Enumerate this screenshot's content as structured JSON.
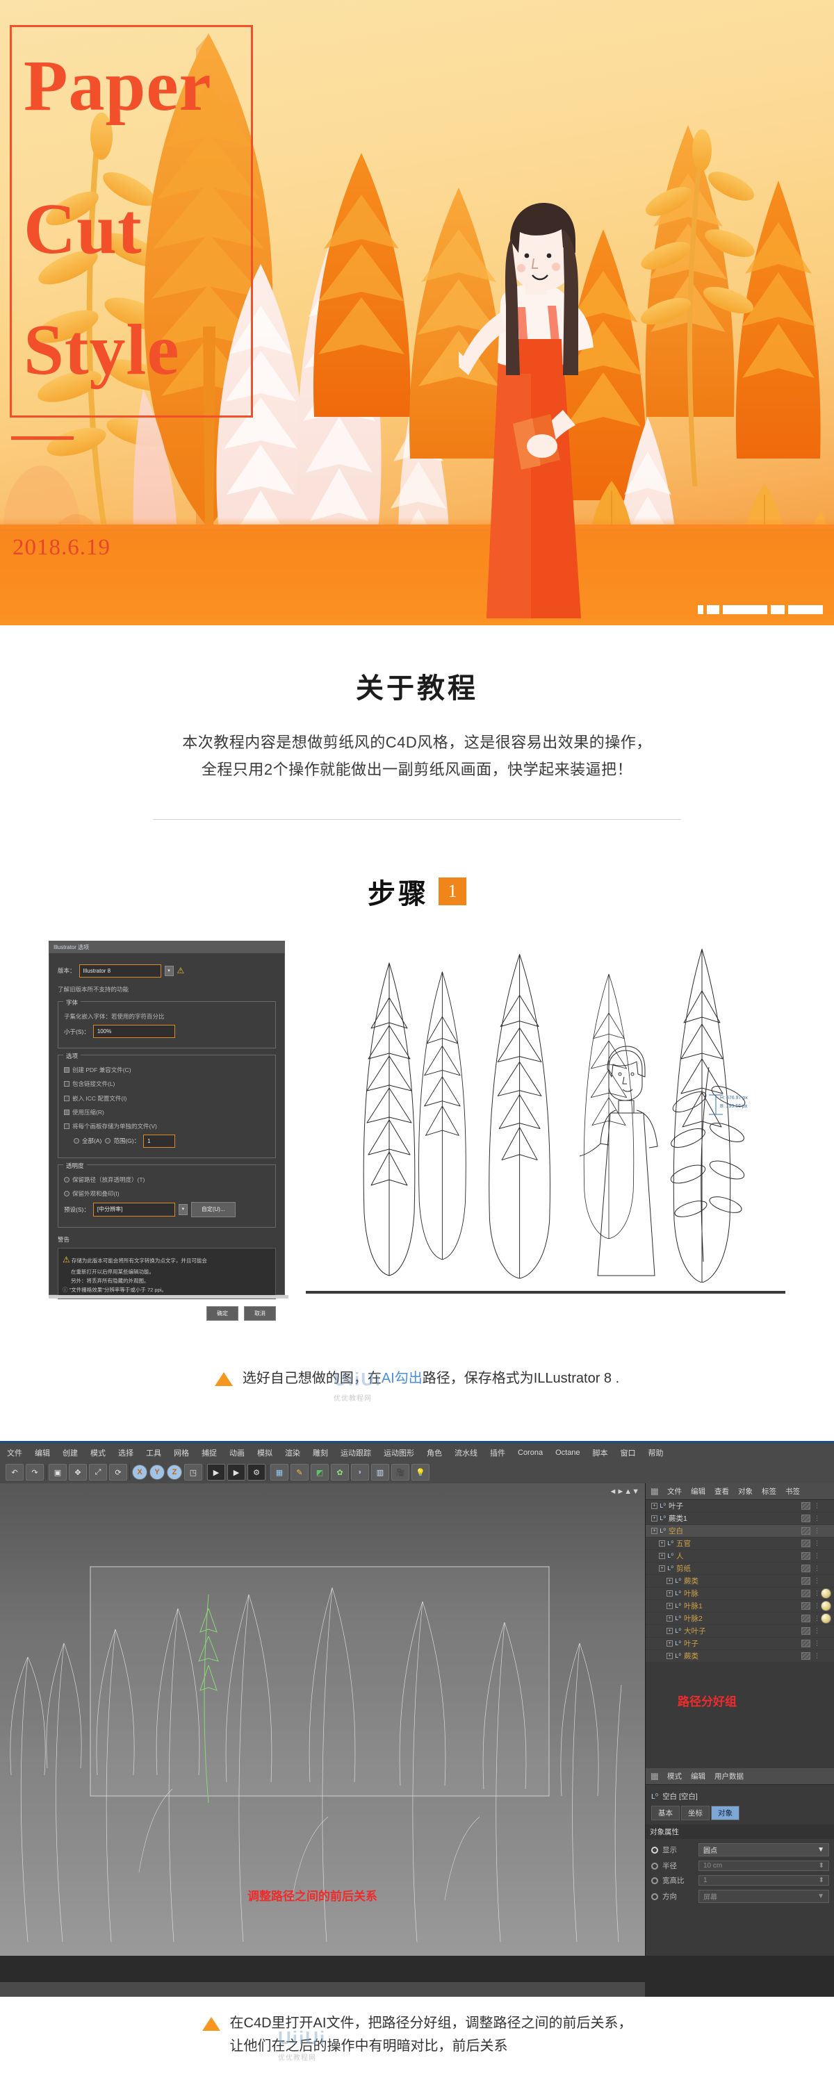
{
  "hero": {
    "title_lines": [
      "Paper",
      "Cut",
      "Style"
    ],
    "date": "2018.6.19",
    "frame_color": "#f2502a",
    "title_color": "#f2502a",
    "pager_dots": 5
  },
  "about": {
    "heading": "关于教程",
    "paragraph_line1": "本次教程内容是想做剪纸风的C4D风格，这是很容易出效果的操作，",
    "paragraph_line2": "全程只用2个操作就能做出一副剪纸风画面，快学起来装逼把！"
  },
  "step1": {
    "heading": "步骤",
    "number": "1",
    "accent_color": "#f08519",
    "caption_pre": "选好自己想做的图，在",
    "caption_hl": "AI勾出",
    "caption_post": "路径，保存格式为ILLustrator 8 .",
    "watermark": "优优教程网",
    "ai_dialog": {
      "title": "Illustrator 选项",
      "version_label": "版本：",
      "version_value": "Illustrator 8",
      "note": "了解旧版本所不支持的功能",
      "font_group": "字体",
      "font_line1": "子集化嵌入字体：若使用的字符百分比",
      "font_line2": "小于(S)：",
      "font_value": "100%",
      "options_group": "选项",
      "opt1": "创建 PDF 兼容文件(C)",
      "opt2": "包含链接文件(L)",
      "opt3": "嵌入 ICC 配置文件(I)",
      "opt4": "使用压缩(R)",
      "opt5": "将每个画板存储为单独的文件(V)",
      "opt_radio1": "全部(A)",
      "opt_radio2": "范围(G)：",
      "range_value": "1",
      "trans_group": "透明度",
      "trans1": "保留路径（放弃透明度）(T)",
      "trans2": "保留外观和叠印(I)",
      "preset_label": "预设(S)：",
      "preset_value": "[中分辨率]",
      "custom_btn": "自定(U)...",
      "warn_group": "警告",
      "warn_line1": "存储为此版本可能会将所有文字转换为点文字，并且可能会",
      "warn_line2": "在重新打开以后停用某些编辑功能。",
      "warn_line3": "另外：将丢弃所有隐藏的外观图。",
      "warn_line4": "\"文件栅格效果\"分辨率等于或小于 72 ppi。",
      "ok": "确定",
      "cancel": "取消"
    }
  },
  "step2": {
    "caption_line1": "在C4D里打开AI文件，把路径分好组，调整路径之间的前后关系，",
    "caption_line2": "让他们在之后的操作中有明暗对比，前后关系",
    "c4d": {
      "menu": [
        "文件",
        "编辑",
        "创建",
        "模式",
        "选择",
        "工具",
        "网格",
        "捕捉",
        "动画",
        "模拟",
        "渲染",
        "雕刻",
        "运动跟踪",
        "运动图形",
        "角色",
        "流水线",
        "插件",
        "Corona",
        "Octane",
        "脚本",
        "窗口",
        "帮助"
      ],
      "axis_labels": [
        "X",
        "Y",
        "Z"
      ],
      "viewport_note": "◄►▲▼",
      "red_note_objects": "路径分好组",
      "red_note_viewport": "调整路径之间的前后关系",
      "object_manager": {
        "menu": [
          "文件",
          "编辑",
          "查看",
          "对象",
          "标签",
          "书签"
        ],
        "items": [
          {
            "name": "叶子",
            "depth": 0,
            "color": "white",
            "mat": false
          },
          {
            "name": "蕨类1",
            "depth": 0,
            "color": "white",
            "mat": false
          },
          {
            "name": "空白",
            "depth": 0,
            "color": "gold",
            "mat": false,
            "selected": true
          },
          {
            "name": "五官",
            "depth": 1,
            "color": "gold",
            "mat": false
          },
          {
            "name": "人",
            "depth": 1,
            "color": "gold",
            "mat": false
          },
          {
            "name": "剪纸",
            "depth": 1,
            "color": "gold",
            "mat": false
          },
          {
            "name": "蕨类",
            "depth": 2,
            "color": "gold",
            "mat": false
          },
          {
            "name": "叶脉",
            "depth": 2,
            "color": "gold",
            "mat": true
          },
          {
            "name": "叶脉1",
            "depth": 2,
            "color": "gold",
            "mat": true
          },
          {
            "name": "叶脉2",
            "depth": 2,
            "color": "gold",
            "mat": true
          },
          {
            "name": "大叶子",
            "depth": 2,
            "color": "gold",
            "mat": false
          },
          {
            "name": "叶子",
            "depth": 2,
            "color": "gold",
            "mat": false
          },
          {
            "name": "蕨类",
            "depth": 2,
            "color": "gold",
            "mat": false
          }
        ]
      },
      "attributes": {
        "menu": [
          "模式",
          "编辑",
          "用户数据"
        ],
        "object_title": "空白 [空白]",
        "tabs": [
          "基本",
          "坐标",
          "对象"
        ],
        "active_tab": "对象",
        "section": "对象属性",
        "rows": [
          {
            "label": "显示",
            "value": "圆点",
            "type": "select",
            "on": true
          },
          {
            "label": "半径",
            "value": "10 cm",
            "type": "number",
            "on": false
          },
          {
            "label": "宽高比",
            "value": "1",
            "type": "number",
            "on": false
          },
          {
            "label": "方向",
            "value": "屏幕",
            "type": "select",
            "on": false
          }
        ]
      }
    }
  }
}
